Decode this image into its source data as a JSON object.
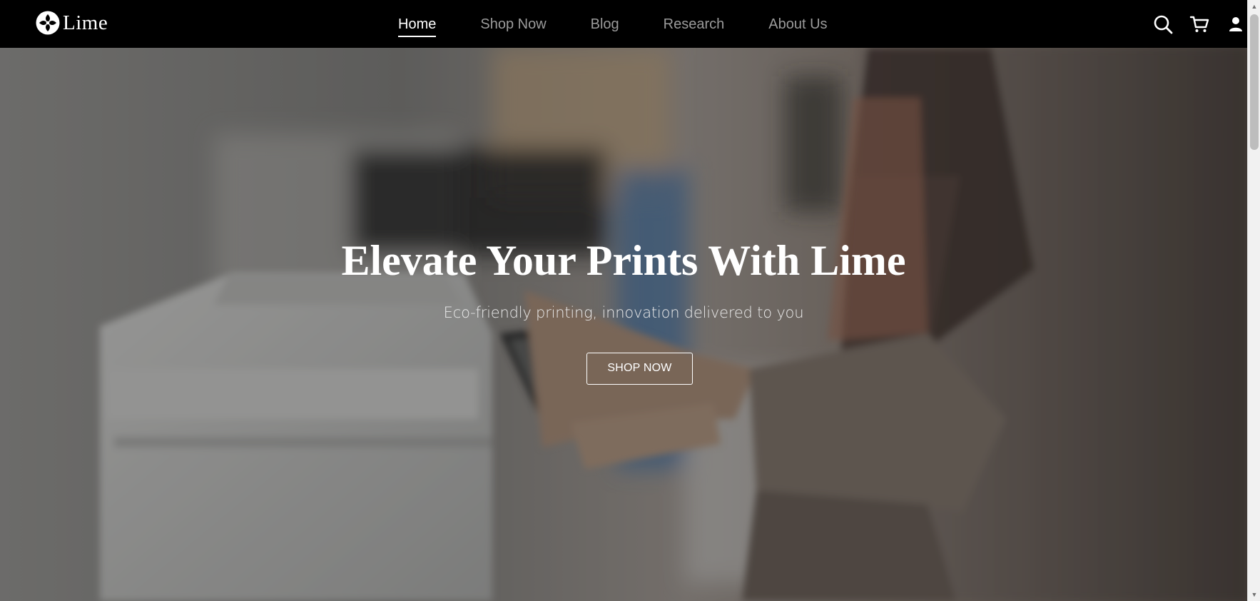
{
  "header": {
    "brand": "Lime",
    "logo_icon": "flower-icon",
    "nav": [
      {
        "label": "Home",
        "active": true
      },
      {
        "label": "Shop Now",
        "active": false
      },
      {
        "label": "Blog",
        "active": false
      },
      {
        "label": "Research",
        "active": false
      },
      {
        "label": "About Us",
        "active": false
      }
    ],
    "icons": [
      "search-icon",
      "cart-icon",
      "user-icon"
    ]
  },
  "hero": {
    "title": "Elevate Your Prints With Lime",
    "subtitle": "Eco-friendly printing, innovation delivered to you",
    "button_label": "SHOP NOW",
    "background_image": "blurred-printer-person-photo"
  },
  "colors": {
    "header_bg": "#000000",
    "nav_inactive": "#9b9b9b",
    "nav_active": "#ffffff",
    "hero_text": "#ffffff"
  },
  "scrollbar": {
    "up_arrow": "▲",
    "down_arrow": "▼"
  }
}
